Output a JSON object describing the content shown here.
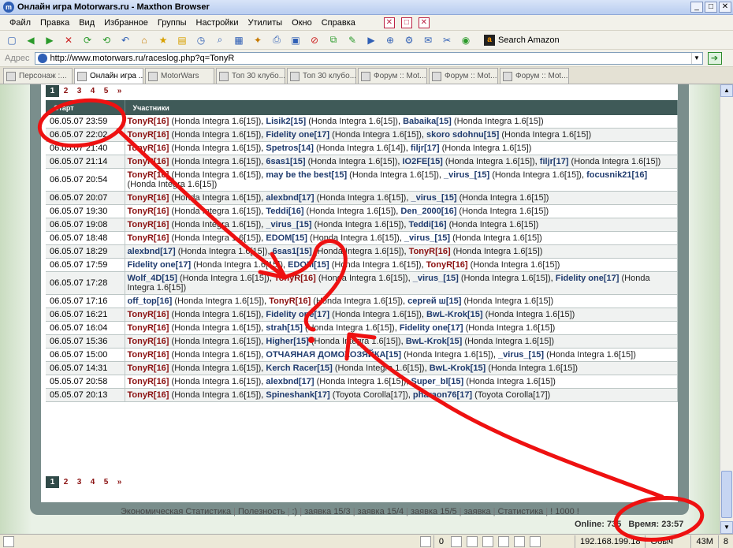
{
  "window": {
    "title": "Онлайн игра Motorwars.ru - Maxthon Browser"
  },
  "menu": [
    "Файл",
    "Правка",
    "Вид",
    "Избранное",
    "Группы",
    "Настройки",
    "Утилиты",
    "Окно",
    "Справка"
  ],
  "toolbar": {
    "search_label": "Search Amazon"
  },
  "address": {
    "label": "Адрес",
    "url": "http://www.motorwars.ru/raceslog.php?q=TonyR"
  },
  "tabs": [
    "Персонаж :...",
    "Онлайн игра ...",
    "MotorWars",
    "Топ 30 клубо...",
    "Топ 30 клубо...",
    "Форум :: Mot...",
    "Форум :: Mot...",
    "Форум :: Mot..."
  ],
  "pager": {
    "pages": [
      "1",
      "2",
      "3",
      "4",
      "5",
      "»"
    ],
    "current": "1"
  },
  "table": {
    "headers": {
      "start": "Старт",
      "participants": "Участники"
    },
    "rows": [
      {
        "date": "06.05.07 23:59",
        "p": [
          [
            "TonyR[16]",
            "(Honda Integra 1.6[15])"
          ],
          [
            "Lisik2[15]",
            "(Honda Integra 1.6[15])"
          ],
          [
            "Babaika[15]",
            "(Honda Integra 1.6[15])"
          ]
        ]
      },
      {
        "date": "06.05.07 22:02",
        "p": [
          [
            "TonyR[16]",
            "(Honda Integra 1.6[15])"
          ],
          [
            "Fidelity one[17]",
            "(Honda Integra 1.6[15])"
          ],
          [
            "skoro sdohnu[15]",
            "(Honda Integra 1.6[15])"
          ]
        ]
      },
      {
        "date": "06.05.07 21:40",
        "p": [
          [
            "TonyR[16]",
            "(Honda Integra 1.6[15])"
          ],
          [
            "Spetros[14]",
            "(Honda Integra 1.6[14])"
          ],
          [
            "filjr[17]",
            "(Honda Integra 1.6[15])"
          ]
        ]
      },
      {
        "date": "06.05.07 21:14",
        "p": [
          [
            "TonyR[16]",
            "(Honda Integra 1.6[15])"
          ],
          [
            "6sas1[15]",
            "(Honda Integra 1.6[15])"
          ],
          [
            "IO2FE[15]",
            "(Honda Integra 1.6[15])"
          ],
          [
            "filjr[17]",
            "(Honda Integra 1.6[15])"
          ]
        ]
      },
      {
        "date": "06.05.07 20:54",
        "p": [
          [
            "TonyR[16]",
            "(Honda Integra 1.6[15])"
          ],
          [
            "may be the best[15]",
            "(Honda Integra 1.6[15])"
          ],
          [
            "_virus_[15]",
            "(Honda Integra 1.6[15])"
          ],
          [
            "focusnik21[16]",
            "(Honda Integra 1.6[15])"
          ]
        ]
      },
      {
        "date": "06.05.07 20:07",
        "p": [
          [
            "TonyR[16]",
            "(Honda Integra 1.6[15])"
          ],
          [
            "alexbnd[17]",
            "(Honda Integra 1.6[15])"
          ],
          [
            "_virus_[15]",
            "(Honda Integra 1.6[15])"
          ]
        ]
      },
      {
        "date": "06.05.07 19:30",
        "p": [
          [
            "TonyR[16]",
            "(Honda Integra 1.6[15])"
          ],
          [
            "Teddi[16]",
            "(Honda Integra 1.6[15])"
          ],
          [
            "Den_2000[16]",
            "(Honda Integra 1.6[15])"
          ]
        ]
      },
      {
        "date": "06.05.07 19:08",
        "p": [
          [
            "TonyR[16]",
            "(Honda Integra 1.6[15])"
          ],
          [
            "_virus_[15]",
            "(Honda Integra 1.6[15])"
          ],
          [
            "Teddi[16]",
            "(Honda Integra 1.6[15])"
          ]
        ]
      },
      {
        "date": "06.05.07 18:48",
        "p": [
          [
            "TonyR[16]",
            "(Honda Integra 1.6[15])"
          ],
          [
            "EDOM[15]",
            "(Honda Integra 1.6[15])"
          ],
          [
            "_virus_[15]",
            "(Honda Integra 1.6[15])"
          ]
        ]
      },
      {
        "date": "06.05.07 18:29",
        "p": [
          [
            "alexbnd[17]",
            "(Honda Integra 1.6[15])"
          ],
          [
            "6sas1[15]",
            "(Honda Integra 1.6[15])"
          ],
          [
            "TonyR[16]",
            "(Honda Integra 1.6[15])"
          ]
        ]
      },
      {
        "date": "06.05.07 17:59",
        "p": [
          [
            "Fidelity one[17]",
            "(Honda Integra 1.6[15])"
          ],
          [
            "EDOM[15]",
            "(Honda Integra 1.6[15])"
          ],
          [
            "TonyR[16]",
            "(Honda Integra 1.6[15])"
          ]
        ]
      },
      {
        "date": "06.05.07 17:28",
        "p": [
          [
            "Wolf_4D[15]",
            "(Honda Integra 1.6[15])"
          ],
          [
            "TonyR[16]",
            "(Honda Integra 1.6[15])"
          ],
          [
            "_virus_[15]",
            "(Honda Integra 1.6[15])"
          ],
          [
            "Fidelity one[17]",
            "(Honda Integra 1.6[15])"
          ]
        ]
      },
      {
        "date": "06.05.07 17:16",
        "p": [
          [
            "off_top[16]",
            "(Honda Integra 1.6[15])"
          ],
          [
            "TonyR[16]",
            "(Honda Integra 1.6[15])"
          ],
          [
            "сергей ш[15]",
            "(Honda Integra 1.6[15])"
          ]
        ]
      },
      {
        "date": "06.05.07 16:21",
        "p": [
          [
            "TonyR[16]",
            "(Honda Integra 1.6[15])"
          ],
          [
            "Fidelity one[17]",
            "(Honda Integra 1.6[15])"
          ],
          [
            "BwL-Krok[15]",
            "(Honda Integra 1.6[15])"
          ]
        ]
      },
      {
        "date": "06.05.07 16:04",
        "p": [
          [
            "TonyR[16]",
            "(Honda Integra 1.6[15])"
          ],
          [
            "strah[15]",
            "(Honda Integra 1.6[15])"
          ],
          [
            "Fidelity one[17]",
            "(Honda Integra 1.6[15])"
          ]
        ]
      },
      {
        "date": "06.05.07 15:36",
        "p": [
          [
            "TonyR[16]",
            "(Honda Integra 1.6[15])"
          ],
          [
            "Higher[15]",
            "(Honda Integra 1.6[15])"
          ],
          [
            "BwL-Krok[15]",
            "(Honda Integra 1.6[15])"
          ]
        ]
      },
      {
        "date": "06.05.07 15:00",
        "p": [
          [
            "TonyR[16]",
            "(Honda Integra 1.6[15])"
          ],
          [
            "ОТЧАЯНАЯ ДОМОХОЗЯЙКА[15]",
            "(Honda Integra 1.6[15])"
          ],
          [
            "_virus_[15]",
            "(Honda Integra 1.6[15])"
          ]
        ]
      },
      {
        "date": "06.05.07 14:31",
        "p": [
          [
            "TonyR[16]",
            "(Honda Integra 1.6[15])"
          ],
          [
            "Kerch Racer[15]",
            "(Honda Integra 1.6[15])"
          ],
          [
            "BwL-Krok[15]",
            "(Honda Integra 1.6[15])"
          ]
        ]
      },
      {
        "date": "05.05.07 20:58",
        "p": [
          [
            "TonyR[16]",
            "(Honda Integra 1.6[15])"
          ],
          [
            "alexbnd[17]",
            "(Honda Integra 1.6[15])"
          ],
          [
            "Super_bl[15]",
            "(Honda Integra 1.6[15])"
          ]
        ]
      },
      {
        "date": "05.05.07 20:13",
        "p": [
          [
            "TonyR[16]",
            "(Honda Integra 1.6[15])"
          ],
          [
            "Spineshank[17]",
            "(Toyota Corolla[17])"
          ],
          [
            "pharaon76[17]",
            "(Toyota Corolla[17])"
          ]
        ]
      }
    ]
  },
  "footer": {
    "links": [
      "Экономическая Статистика",
      "Полезность",
      ":)",
      "заявка 15/3",
      "заявка 15/4",
      "заявка 15/5",
      "заявка",
      "Статистика",
      "! 1000 !"
    ],
    "online": "Online: 735",
    "time": "Время: 23:57"
  },
  "status": {
    "num1": "0",
    "ip": "192.168.199.18",
    "mode": "Обыч",
    "mem": "43M",
    "num2": "8"
  },
  "colors": {
    "header_bg": "#3f5a58",
    "self_name": "#8a1010",
    "other_name": "#1f3b6e",
    "annotation": "#ee1111"
  }
}
